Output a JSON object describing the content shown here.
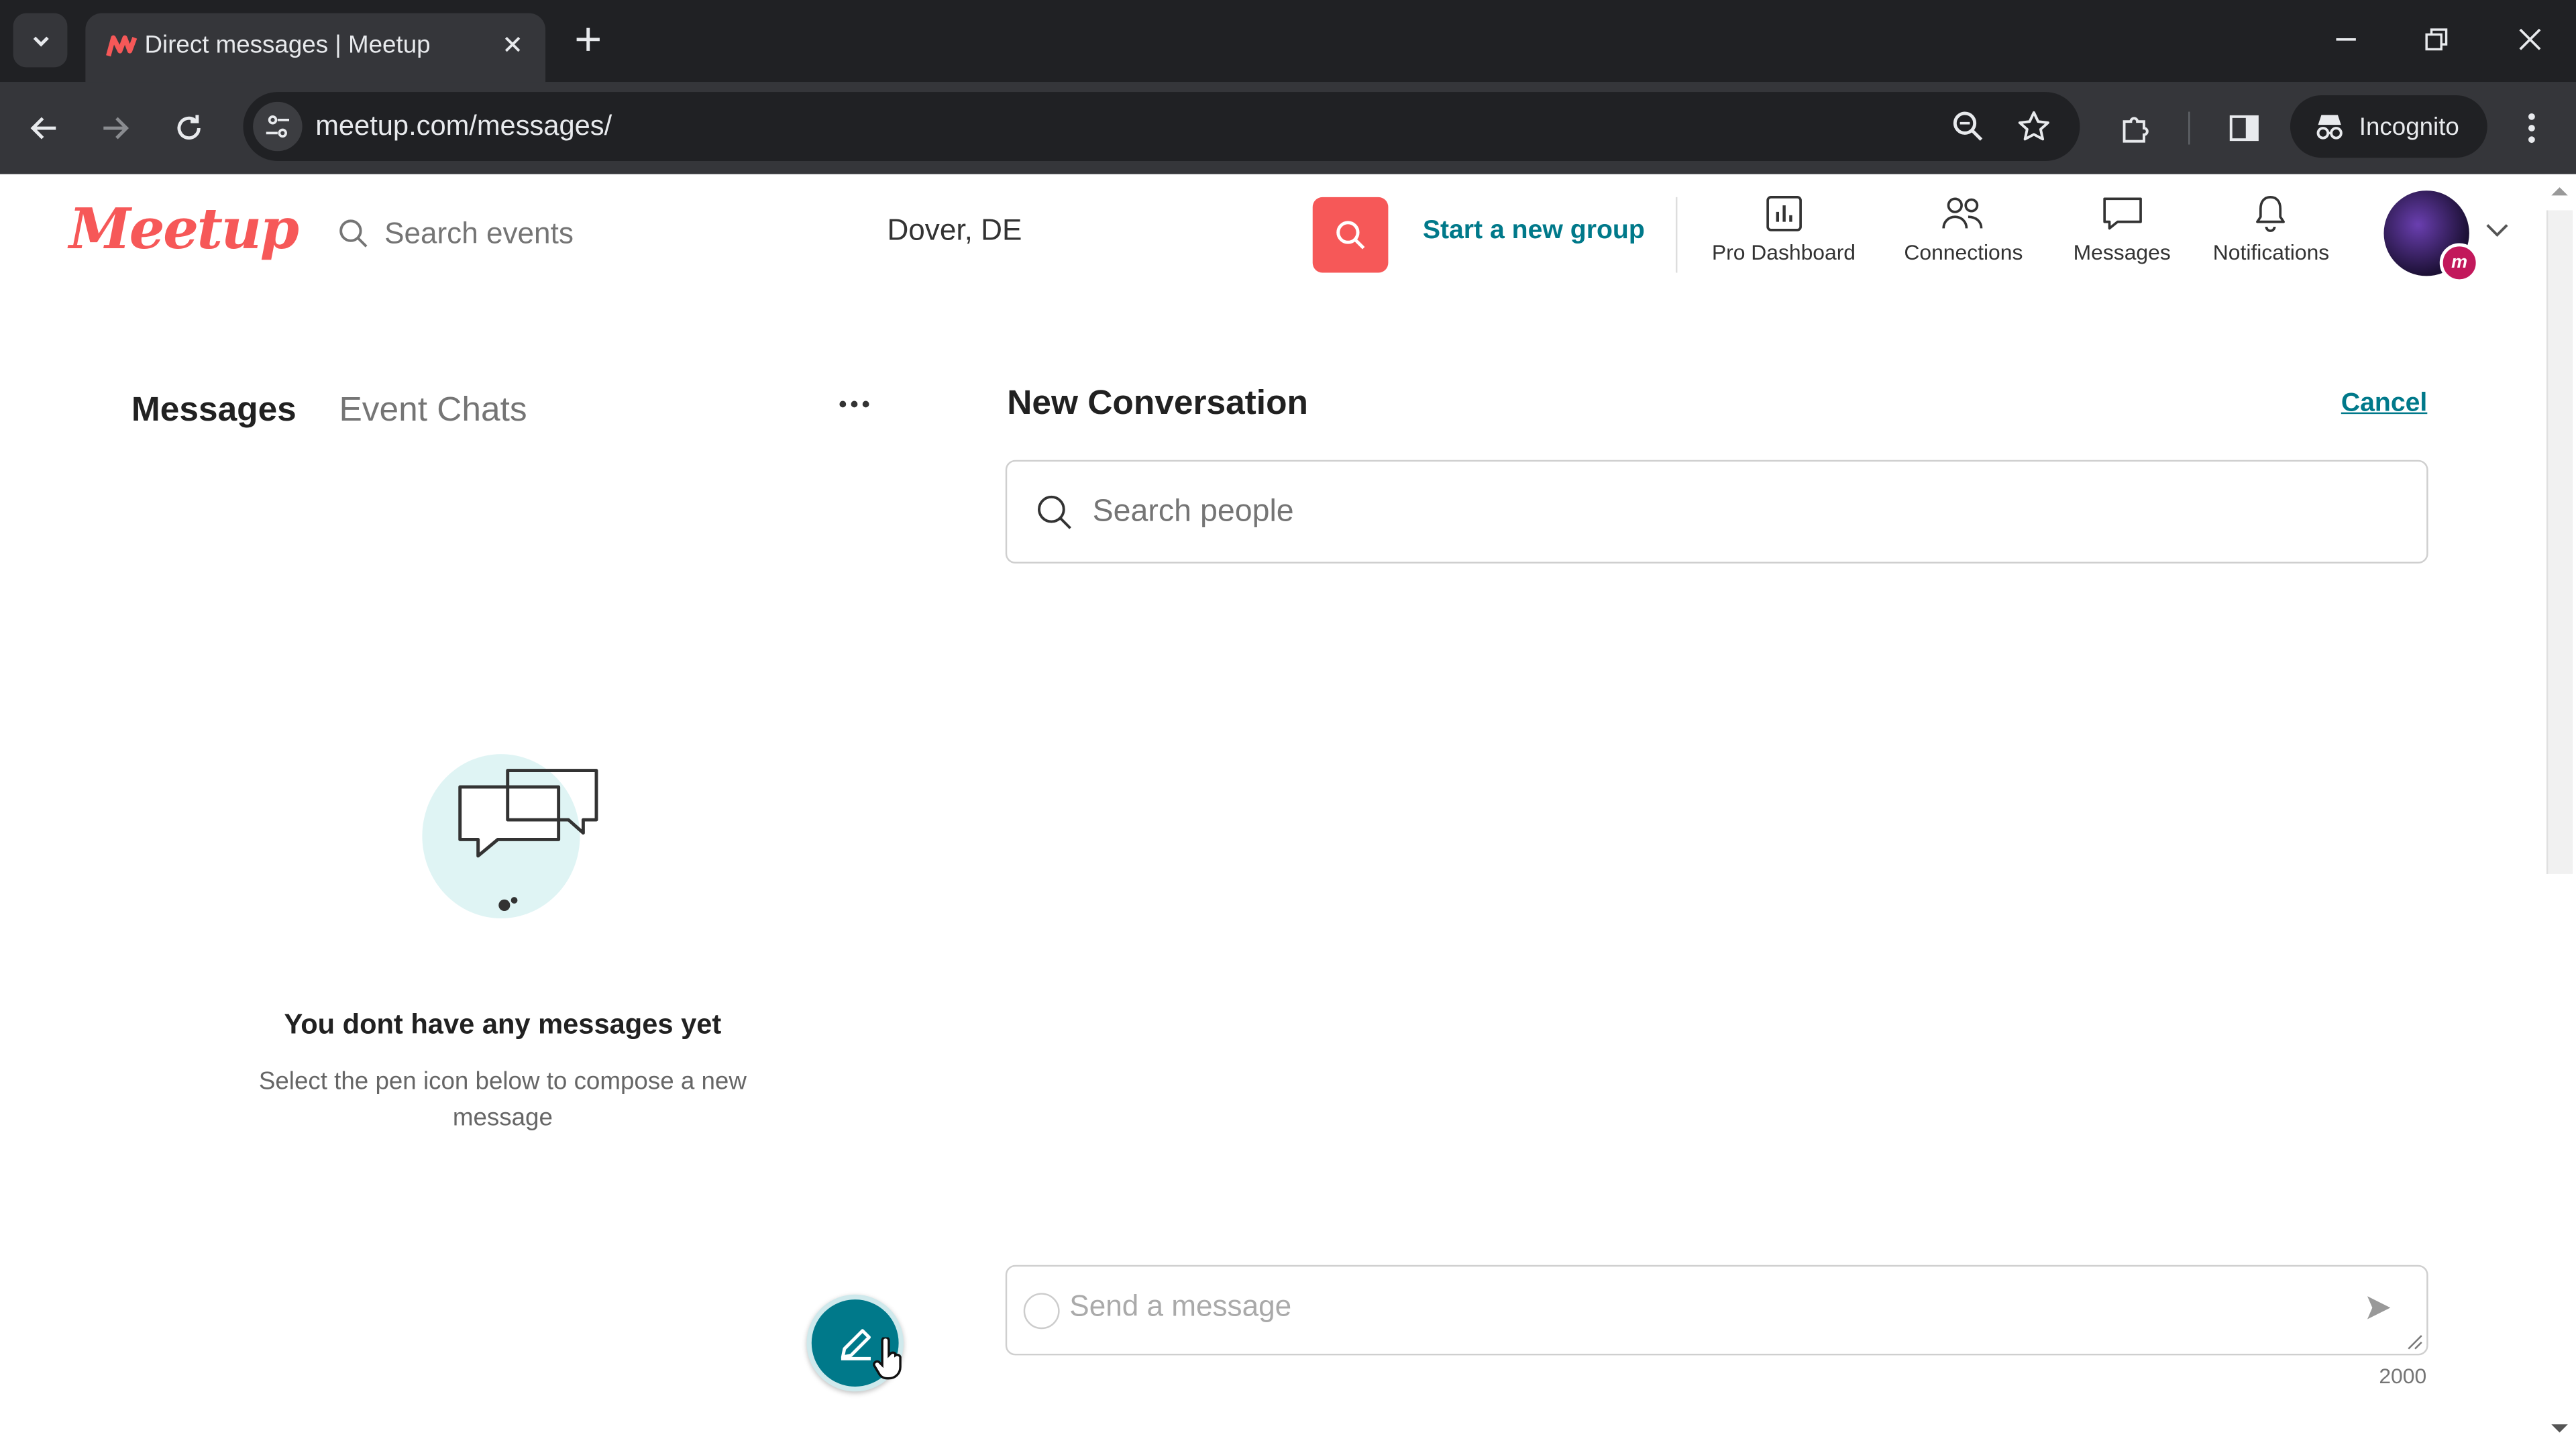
{
  "browser": {
    "tab_title": "Direct messages | Meetup",
    "url": "meetup.com/messages/",
    "incognito_label": "Incognito"
  },
  "header": {
    "logo": "Meetup",
    "search_placeholder": "Search events",
    "location": "Dover, DE",
    "start_group": "Start a new group",
    "nav": [
      {
        "label": "Pro Dashboard",
        "icon": "bar-chart-icon"
      },
      {
        "label": "Connections",
        "icon": "people-icon"
      },
      {
        "label": "Messages",
        "icon": "chat-bubble-icon"
      },
      {
        "label": "Notifications",
        "icon": "bell-icon"
      }
    ],
    "avatar_badge": "m"
  },
  "left_panel": {
    "tabs": [
      "Messages",
      "Event Chats"
    ],
    "empty_title": "You dont have any messages yet",
    "empty_subtitle": "Select the pen icon below to compose a new message"
  },
  "conversation": {
    "title": "New Conversation",
    "cancel": "Cancel",
    "search_placeholder": "Search people",
    "message_placeholder": "Send a message",
    "char_limit": "2000"
  },
  "colors": {
    "brand": "#f65858",
    "teal": "#00798a"
  }
}
